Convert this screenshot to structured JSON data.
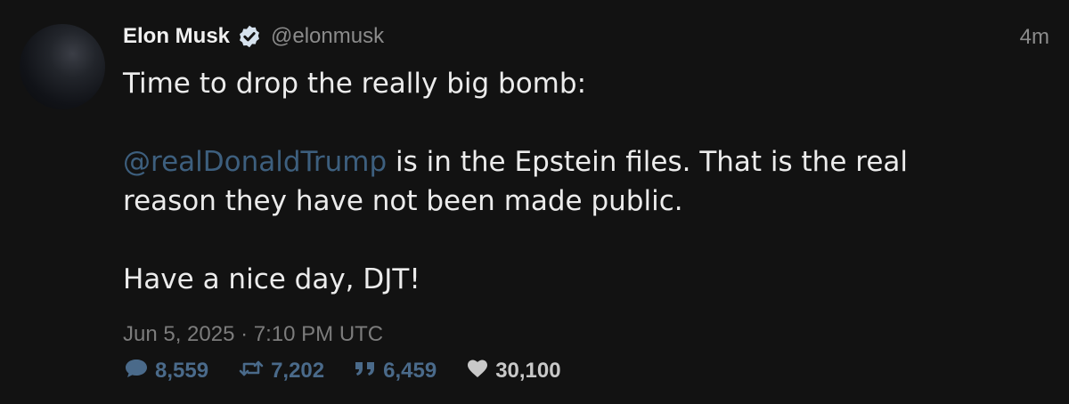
{
  "author": {
    "name": "Elon Musk",
    "handle": "@elonmusk",
    "verified_icon": "verified-badge-icon"
  },
  "tweet": {
    "time_ago": "4m",
    "line1": "Time to drop the really big bomb:",
    "mention": "@realDonaldTrump",
    "line2_rest": " is in the Epstein files. That is the real",
    "line3": "reason they have not been made public.",
    "line4": "Have a nice day, DJT!",
    "timestamp": "Jun 5, 2025 · 7:10 PM UTC"
  },
  "stats": {
    "replies": "8,559",
    "retweets": "7,202",
    "quotes": "6,459",
    "likes": "30,100"
  },
  "colors": {
    "background": "#121212",
    "mention": "#3d5f7e",
    "stat_blue": "#4a6a8a",
    "verified": "#1d9bf0"
  }
}
